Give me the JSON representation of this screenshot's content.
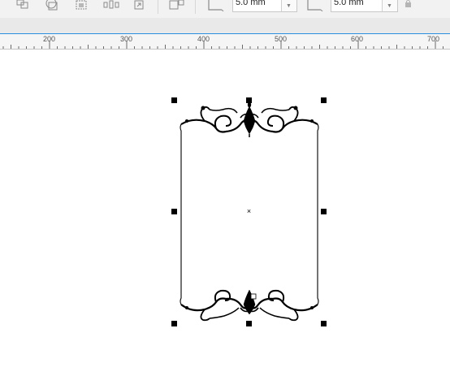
{
  "property_bar": {
    "icons": [
      "combine-icon",
      "intersect-icon",
      "trim-icon",
      "align-distribute-icon",
      "convert-icon",
      "break-apart-icon",
      "corner-shape-icon",
      "corner-shape-icon-2",
      "lock-ratio-icon"
    ],
    "corner_radius_1": {
      "value": "5.0 mm"
    },
    "corner_radius_2": {
      "value": "5.0 mm"
    }
  },
  "ruler": {
    "labels": [
      "200",
      "300",
      "400",
      "500",
      "600",
      "700"
    ]
  },
  "canvas": {
    "object": "ornamental-frame",
    "colors": {
      "handle": "#000000",
      "outline": "#000000",
      "ruler_line": "#2b8de0"
    }
  }
}
